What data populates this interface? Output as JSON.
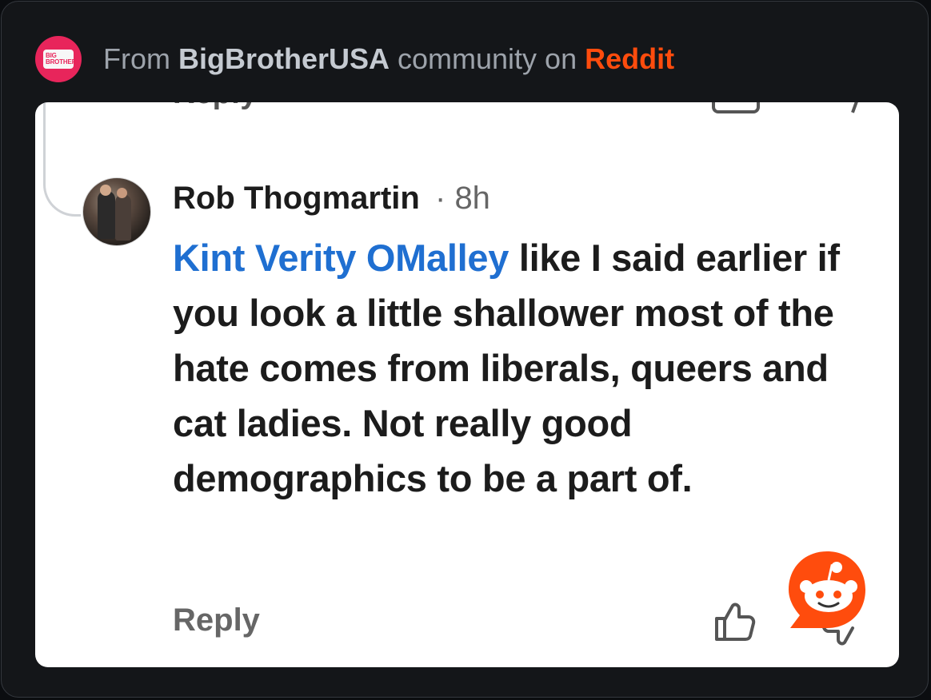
{
  "header": {
    "prefix": "From ",
    "community": "BigBrotherUSA",
    "middle": " community on ",
    "platform": "Reddit",
    "logo_text_line1": "BIG",
    "logo_text_line2": "BROTHER",
    "colors": {
      "platform": "#ff4c0d",
      "logo_bg": "#e8255b"
    }
  },
  "comment": {
    "cut_off_reply": "Reply",
    "author": "Rob Thogmartin",
    "separator": "·",
    "time": "8h",
    "mention": "Kint Verity OMalley",
    "body": " like I said earlier if you look a little shallower most of the hate comes from liberals, queers and cat ladies. Not really good demographics to be a part of.",
    "reply_label": "Reply",
    "icons": [
      "thumbs-up-icon",
      "thumbs-down-icon",
      "reddit-snoo-icon"
    ]
  }
}
